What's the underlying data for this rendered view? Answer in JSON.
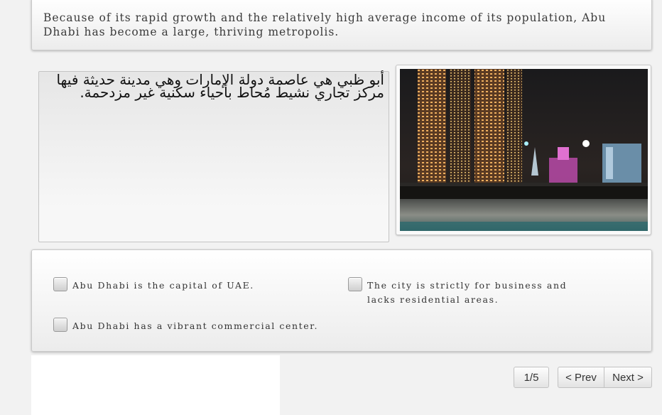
{
  "intro": {
    "text": "Because of its rapid growth and the relatively high average income of its population, Abu Dhabi has become a large, thriving metropolis."
  },
  "arabic": {
    "text": "أبو ظبي هي عاصمة دولة الإمارات وهي مدينة حديثة فيها مركز تجاري نشيط مُحاط بأحياء سكنية غير مزدحمة."
  },
  "image": {
    "subject": "Abu Dhabi skyline at night"
  },
  "options": [
    {
      "label": "Abu Dhabi is the capital of UAE."
    },
    {
      "label": "Abu Dhabi has a vibrant commercial center."
    },
    {
      "label": "The city is strictly for business and lacks residential areas."
    }
  ],
  "pagination": {
    "indicator": "1/5",
    "prev_label": "< Prev",
    "next_label": "Next >"
  }
}
